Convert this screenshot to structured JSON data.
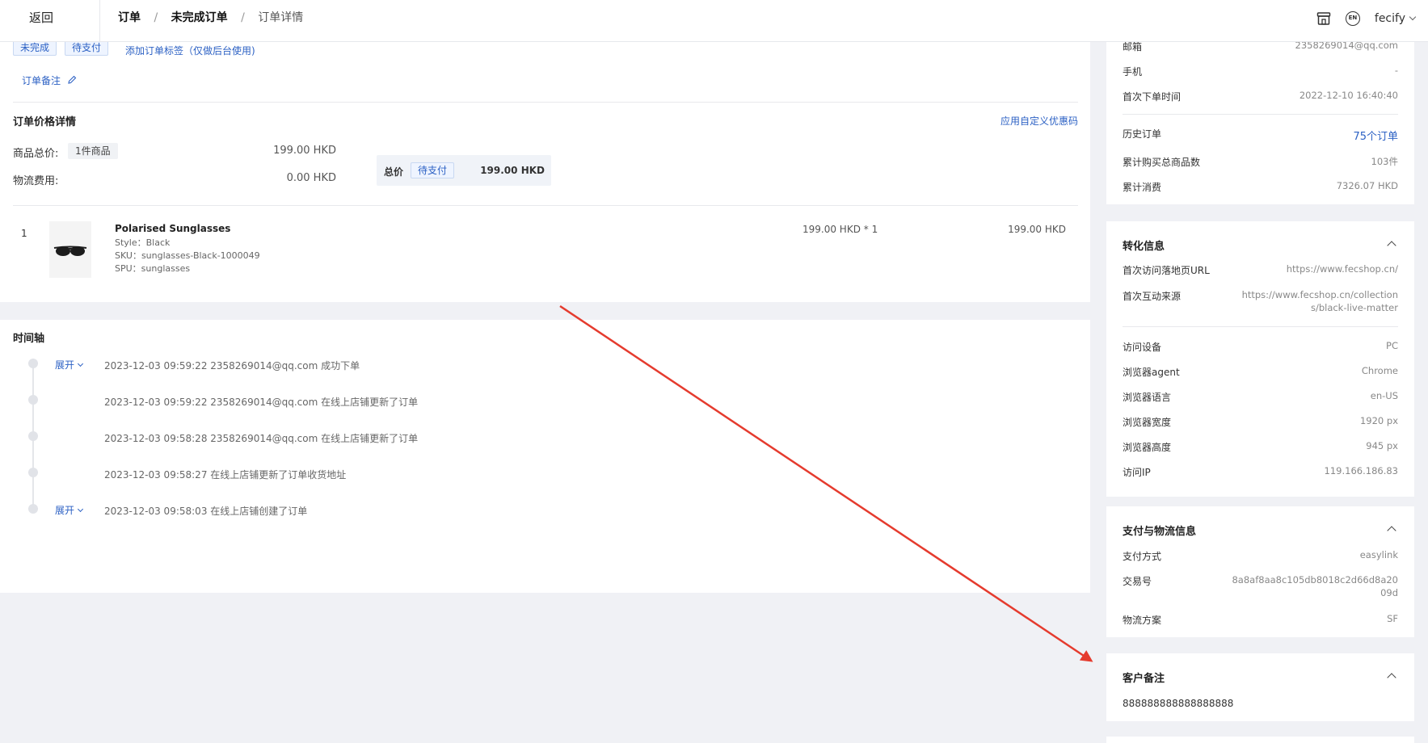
{
  "topbar": {
    "back_label": "返回",
    "crumbs": [
      "订单",
      "未完成订单",
      "订单详情"
    ],
    "separator": "/",
    "user": "fecify",
    "lang_badge": "EN"
  },
  "order": {
    "tags": [
      "未完成",
      "待支付"
    ],
    "add_tag_link": "添加订单标签（仅做后台使用)",
    "note_link": "订单备注"
  },
  "price": {
    "title": "订单价格详情",
    "coupon_link": "应用自定义优惠码",
    "goods_total_label": "商品总价:",
    "goods_count_badge": "1件商品",
    "goods_total_value": "199.00 HKD",
    "shipping_label": "物流费用:",
    "shipping_value": "0.00 HKD",
    "total_label": "总价",
    "total_status": "待支付",
    "total_value": "199.00 HKD"
  },
  "item": {
    "index": "1",
    "name": "Polarised Sunglasses",
    "style": "Style：Black",
    "sku": "SKU：sunglasses-Black-1000049",
    "spu": "SPU：sunglasses",
    "unit": "199.00 HKD * 1",
    "subtotal": "199.00 HKD"
  },
  "timeline": {
    "title": "时间轴",
    "expand_label": "展开",
    "events": [
      {
        "text": "2023-12-03 09:59:22 2358269014@qq.com 成功下单",
        "expandable": true
      },
      {
        "text": "2023-12-03 09:59:22 2358269014@qq.com 在线上店铺更新了订单",
        "expandable": false
      },
      {
        "text": "2023-12-03 09:58:28 2358269014@qq.com 在线上店铺更新了订单",
        "expandable": false
      },
      {
        "text": "2023-12-03 09:58:27 在线上店铺更新了订单收货地址",
        "expandable": false
      },
      {
        "text": "2023-12-03 09:58:03 在线上店铺创建了订单",
        "expandable": true
      }
    ]
  },
  "customer": {
    "email_label": "邮箱",
    "email_value": "2358269014@qq.com",
    "phone_label": "手机",
    "phone_value": "-",
    "first_order_label": "首次下单时间",
    "first_order_value": "2022-12-10 16:40:40",
    "history_label": "历史订单",
    "history_value": "75个订单",
    "total_items_label": "累计购买总商品数",
    "total_items_value": "103件",
    "total_spend_label": "累计消费",
    "total_spend_value": "7326.07 HKD"
  },
  "conversion": {
    "title": "转化信息",
    "landing_label": "首次访问落地页URL",
    "landing_value": "https://www.fecshop.cn/",
    "referrer_label": "首次互动来源",
    "referrer_line1": "https://www.fecshop.cn/collection",
    "referrer_line2": "s/black-live-matter",
    "device_label": "访问设备",
    "device_value": "PC",
    "agent_label": "浏览器agent",
    "agent_value": "Chrome",
    "lang_label": "浏览器语言",
    "lang_value": "en-US",
    "width_label": "浏览器宽度",
    "width_value": "1920 px",
    "height_label": "浏览器高度",
    "height_value": "945 px",
    "ip_label": "访问IP",
    "ip_value": "119.166.186.83"
  },
  "payment": {
    "title": "支付与物流信息",
    "method_label": "支付方式",
    "method_value": "easylink",
    "txn_label": "交易号",
    "txn_line1": "8a8af8aa8c105db8018c2d66d8a20",
    "txn_line2": "09d",
    "shipping_label": "物流方案",
    "shipping_value": "SF"
  },
  "customer_note": {
    "title": "客户备注",
    "text": "888888888888888888"
  },
  "colors": {
    "accent": "#2c61c4",
    "arrow": "#e53b2e"
  }
}
